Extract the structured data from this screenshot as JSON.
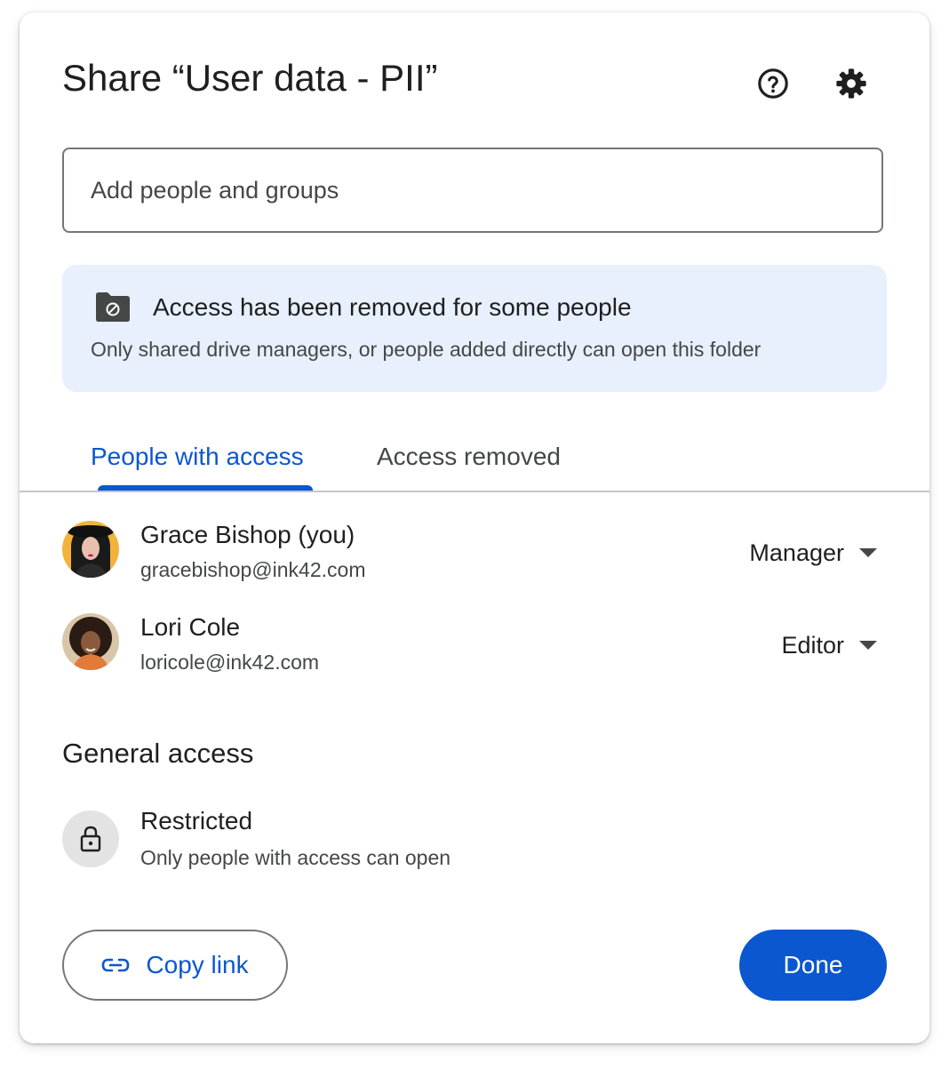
{
  "dialog": {
    "title": "Share “User data - PII”",
    "help_icon": "help-circle-icon",
    "settings_icon": "gear-icon"
  },
  "add_people": {
    "placeholder": "Add people and groups",
    "value": ""
  },
  "banner": {
    "icon": "folder-blocked-icon",
    "title": "Access has been removed for some people",
    "text": "Only shared drive managers, or people added directly can open this folder",
    "background": "#e8f0fe"
  },
  "tabs": [
    {
      "label": "People with access",
      "active": true
    },
    {
      "label": "Access removed",
      "active": false
    }
  ],
  "people": [
    {
      "name": "Grace Bishop (you)",
      "email": "gracebishop@ink42.com",
      "role": "Manager",
      "avatar": "avatar-grace-bishop"
    },
    {
      "name": "Lori Cole",
      "email": "loricole@ink42.com",
      "role": "Editor",
      "avatar": "avatar-lori-cole"
    }
  ],
  "general_access": {
    "heading": "General access",
    "icon": "lock-icon",
    "level": "Restricted",
    "description": "Only people with access can open"
  },
  "actions": {
    "copy_link_label": "Copy link",
    "copy_link_icon": "link-icon",
    "done_label": "Done"
  },
  "colors": {
    "accent": "#0b57d0",
    "text_primary": "#1f1f1f",
    "text_secondary": "#444746",
    "banner_bg": "#e8f0fe"
  }
}
